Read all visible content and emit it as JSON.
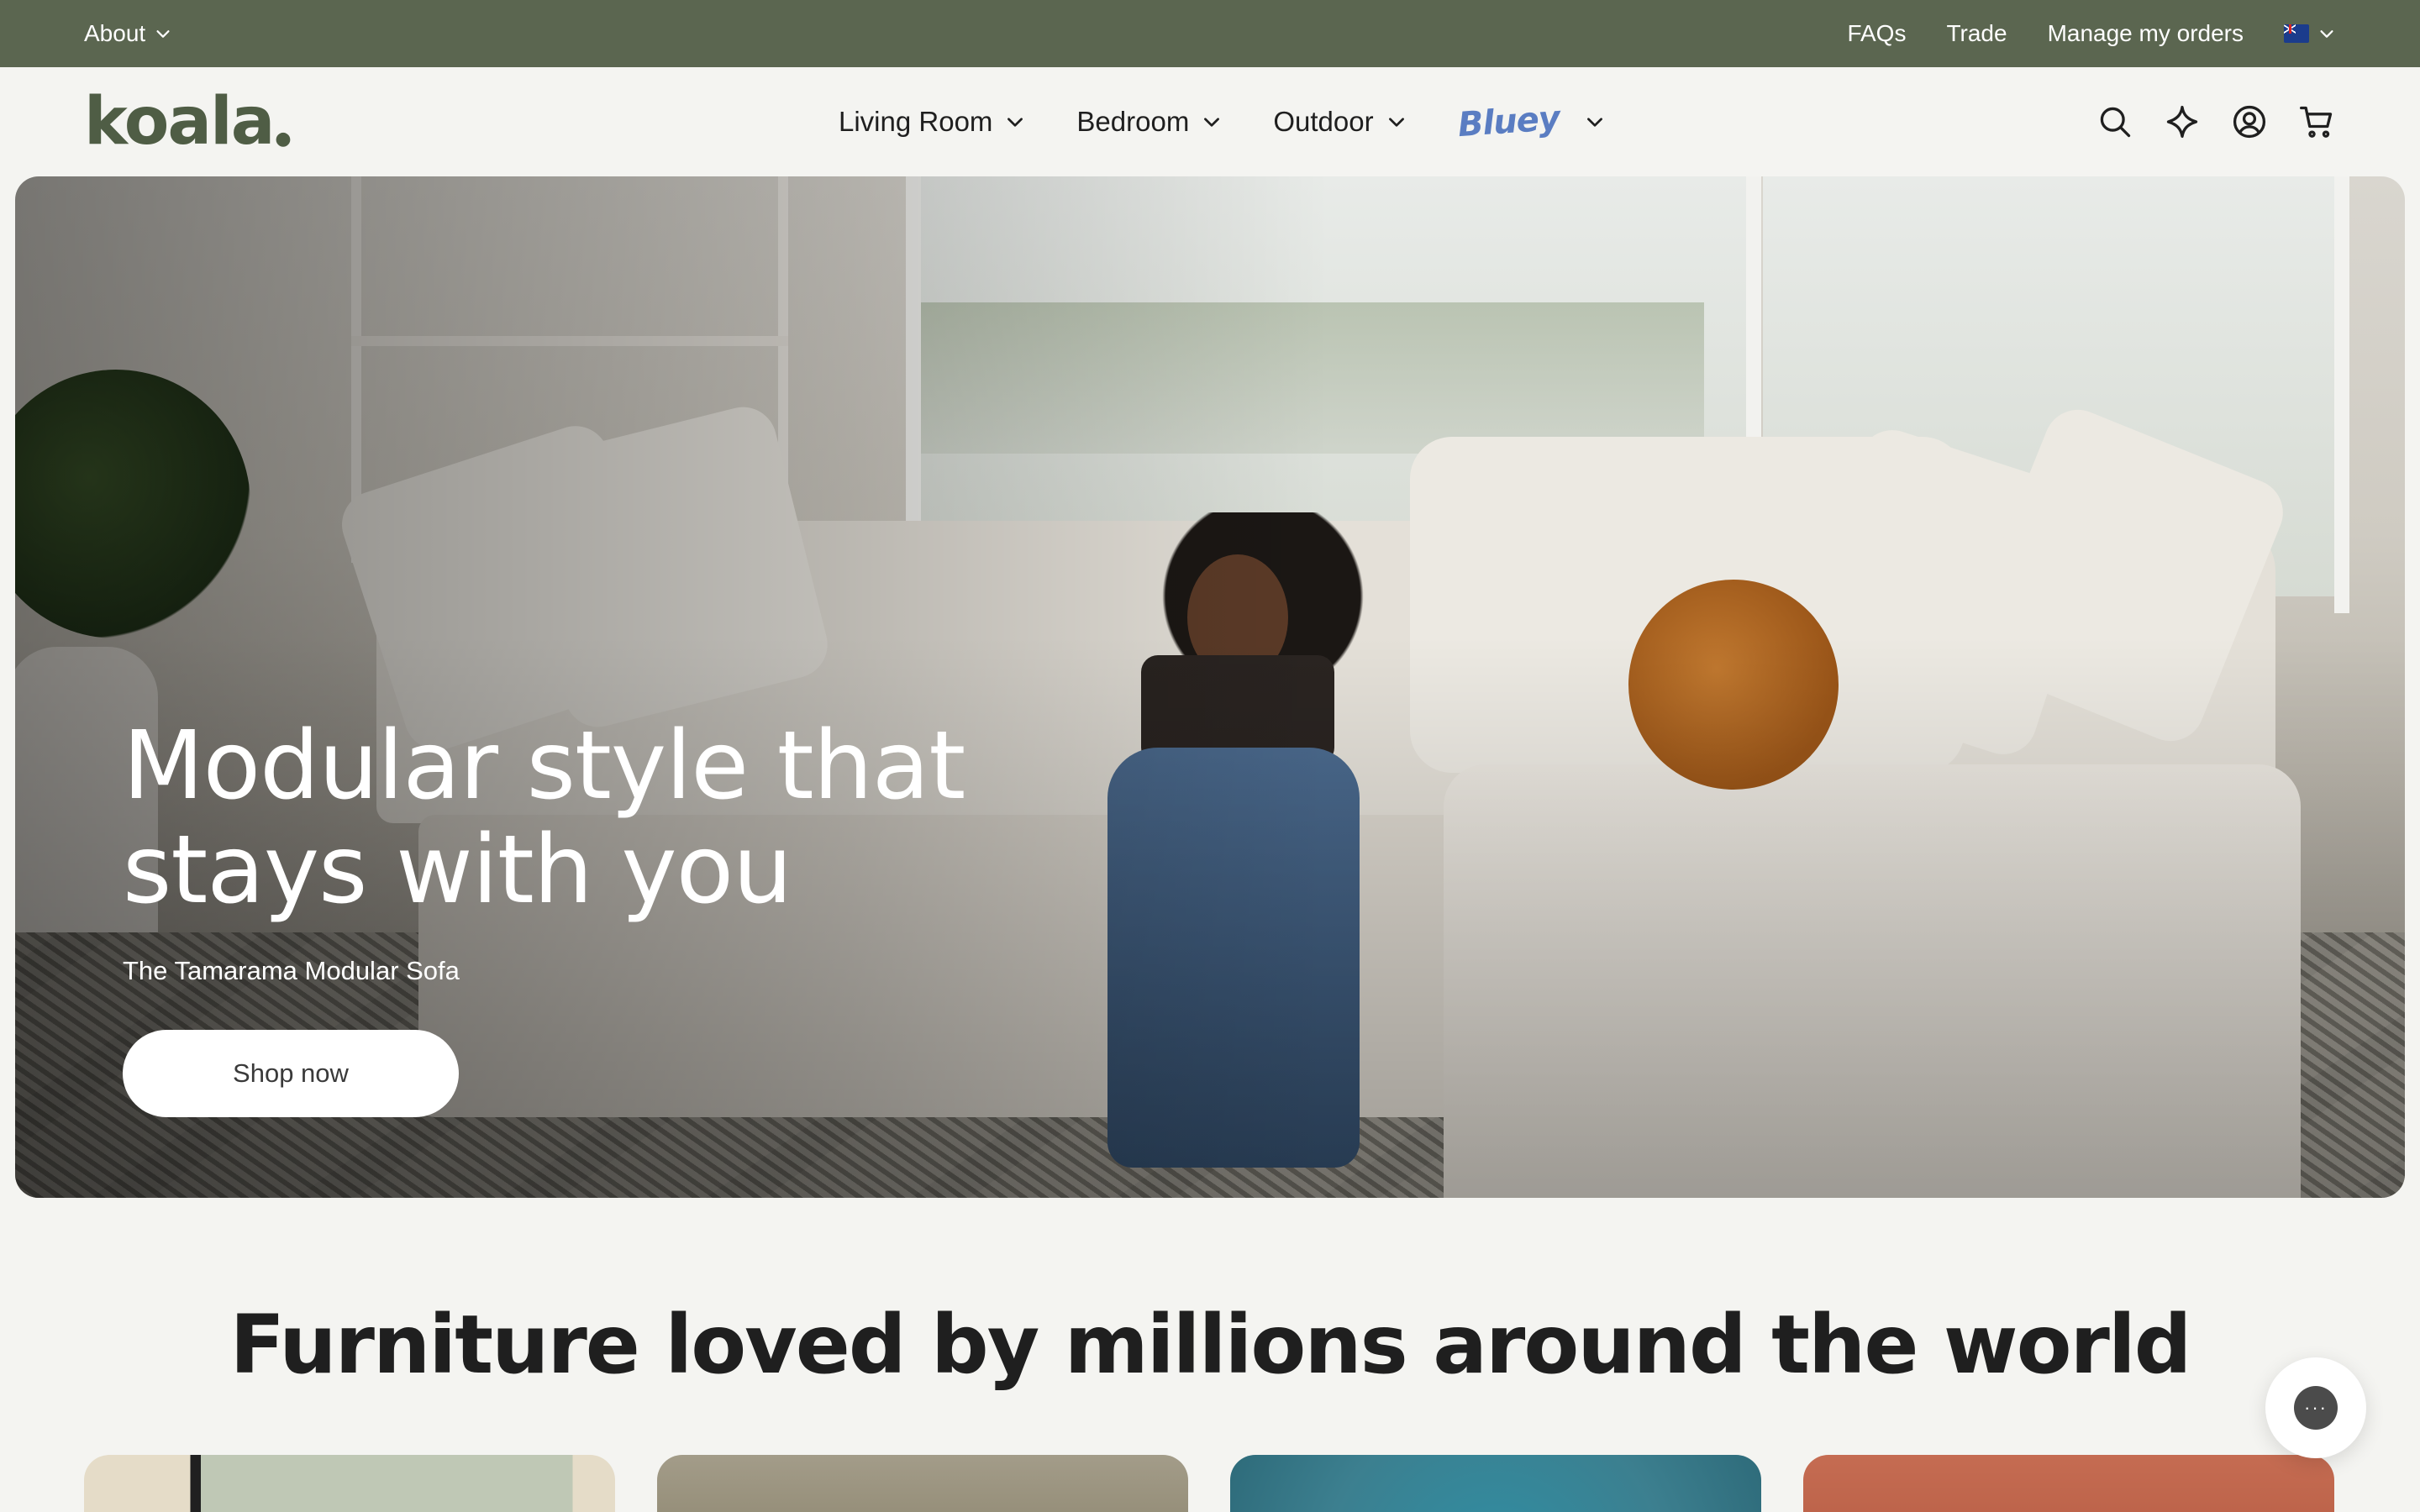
{
  "utility_bar": {
    "about_label": "About",
    "links": [
      "FAQs",
      "Trade",
      "Manage my orders"
    ],
    "region": "AU"
  },
  "header": {
    "logo_text": "koala",
    "nav": [
      {
        "label": "Living Room"
      },
      {
        "label": "Bedroom"
      },
      {
        "label": "Outdoor"
      }
    ],
    "bluey_label": "Bluey",
    "icons": [
      "search-icon",
      "sparkle-icon",
      "account-icon",
      "cart-icon"
    ]
  },
  "hero": {
    "title": "Modular style that stays with you",
    "subtitle": "The Tamarama Modular Sofa",
    "cta_label": "Shop now"
  },
  "section": {
    "title": "Furniture loved by millions around the world"
  },
  "chat": {
    "icon": "chat-icon",
    "glyph": "···"
  },
  "colors": {
    "utility_bar_bg": "#5b6650",
    "logo": "#4f5d45",
    "page_bg": "#f4f4f1",
    "bluey": "#5a7dc2"
  }
}
